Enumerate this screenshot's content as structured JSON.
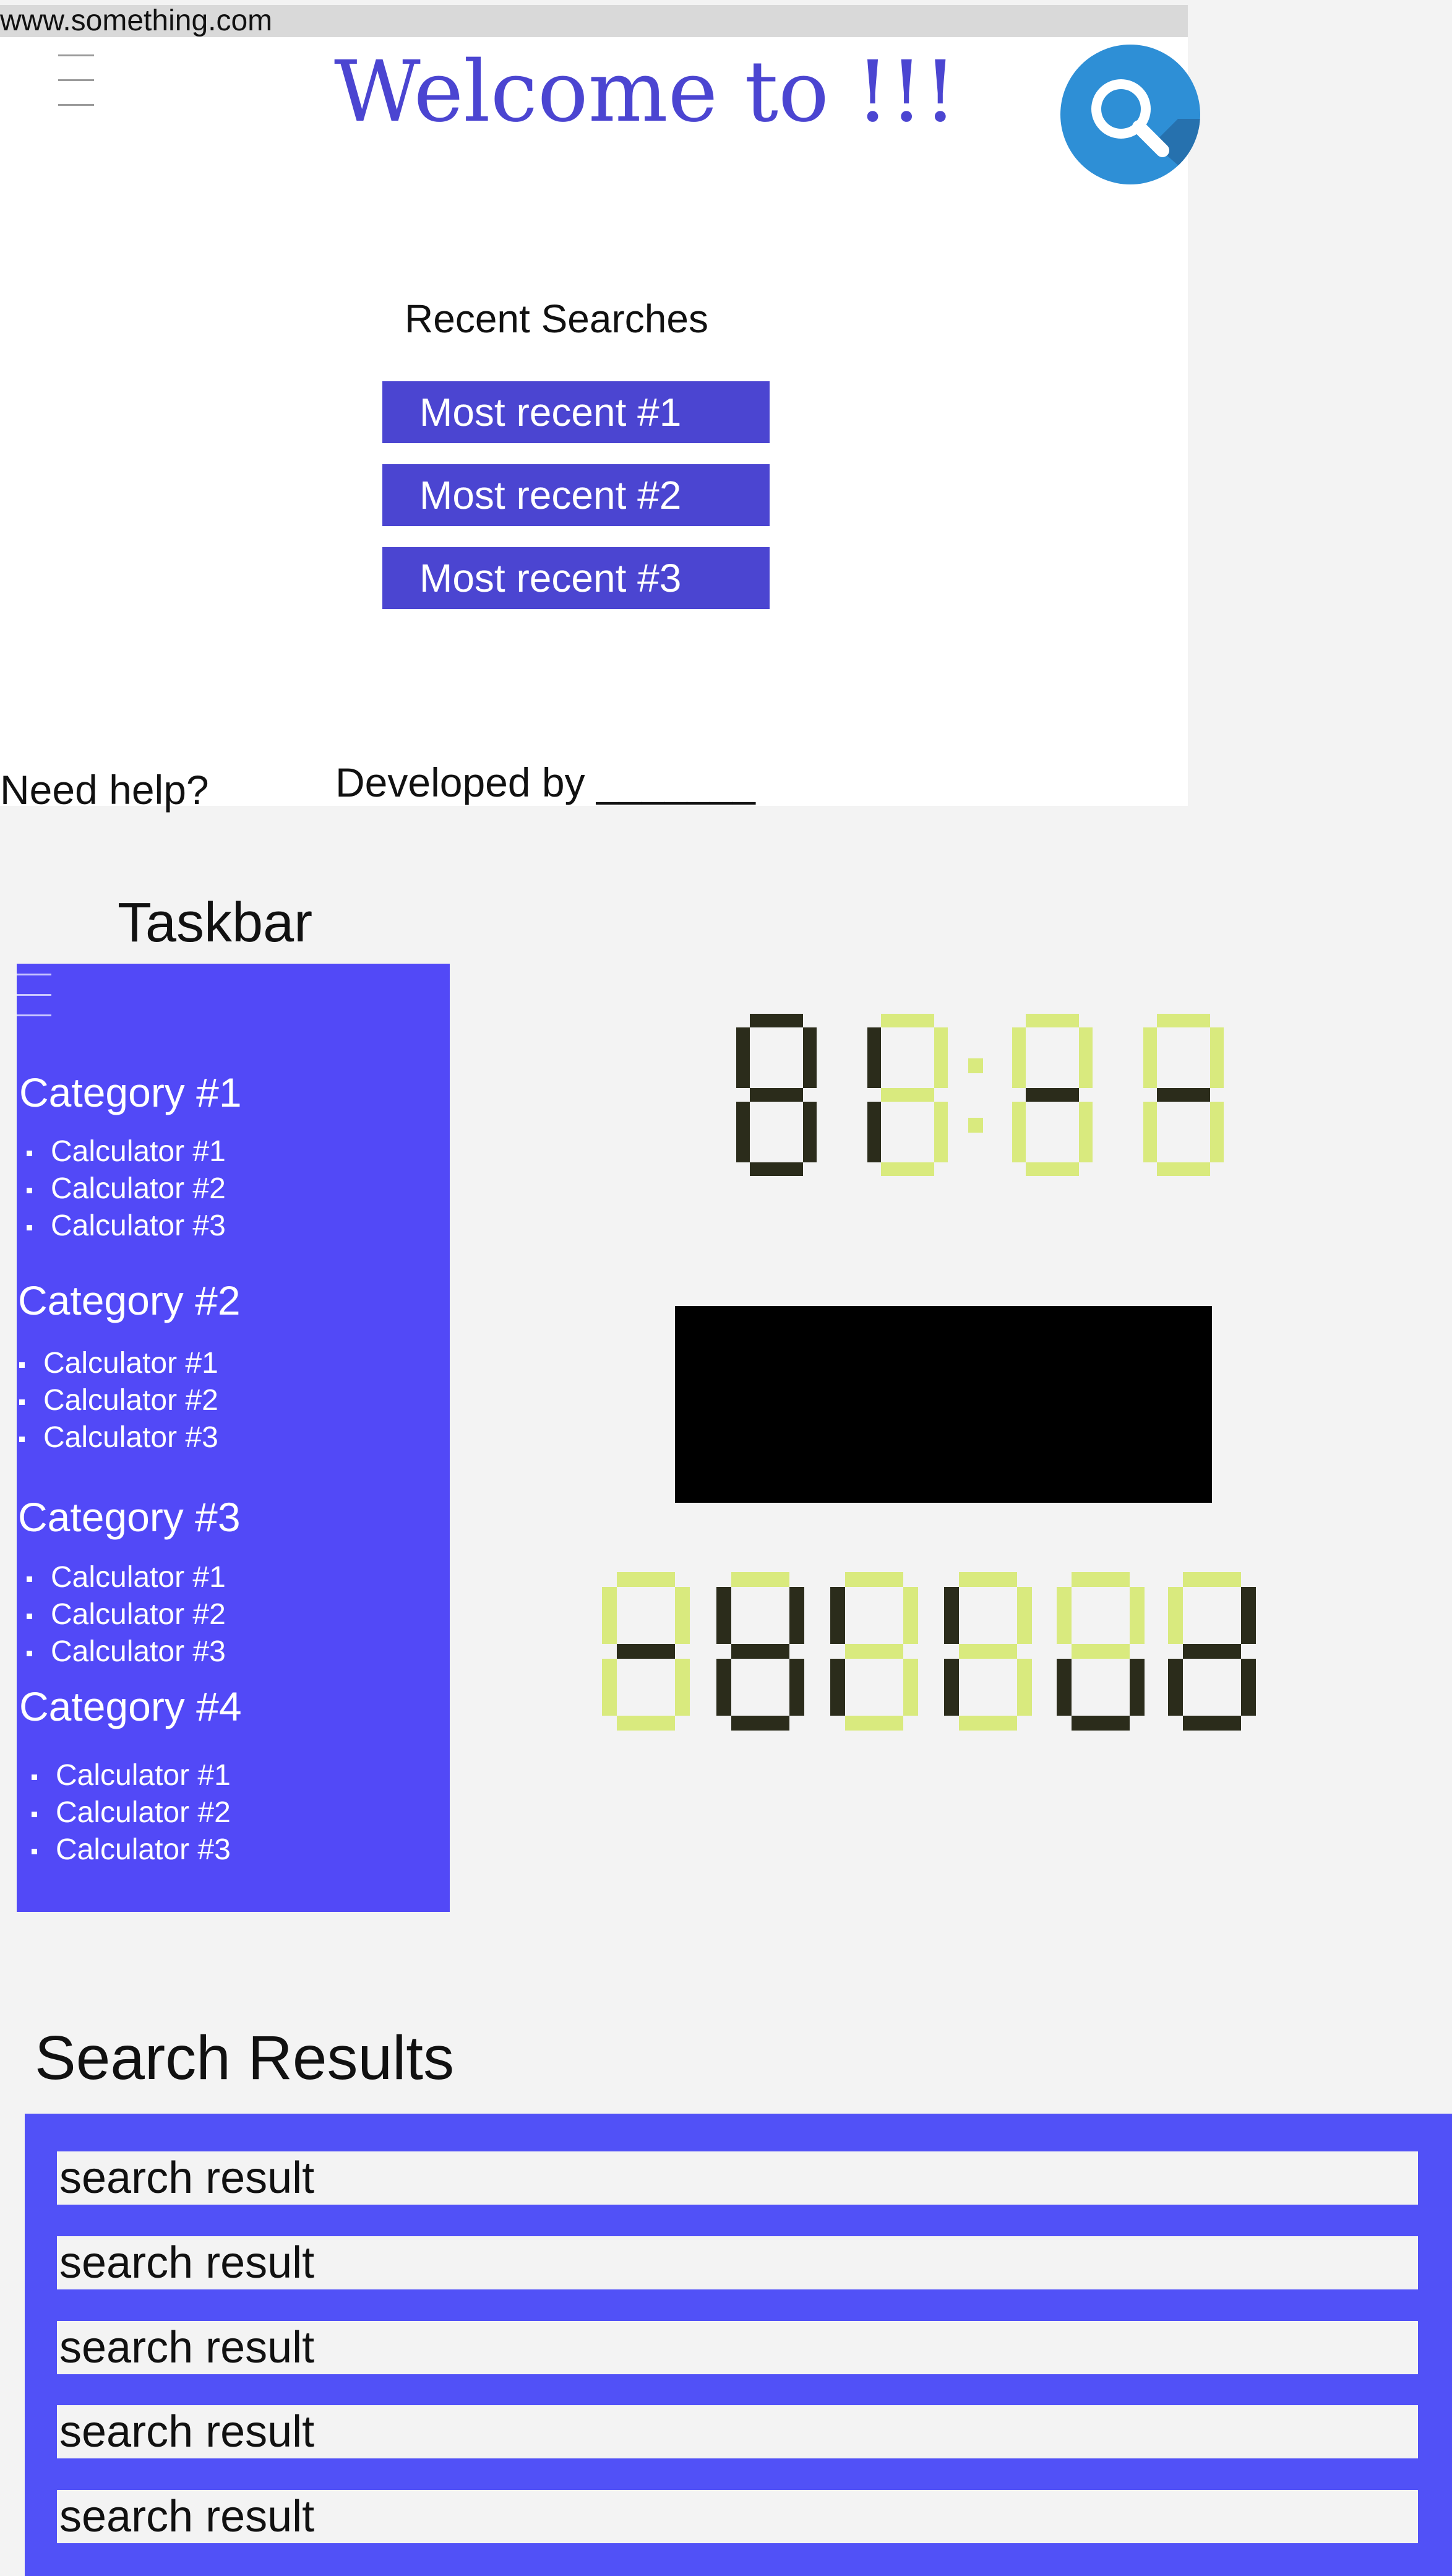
{
  "browser": {
    "url": "www.something.com"
  },
  "header": {
    "title": "Welcome to !!!"
  },
  "recent": {
    "title": "Recent Searches",
    "items": [
      "Most recent #1",
      "Most recent #2",
      "Most recent #3"
    ]
  },
  "footer": {
    "help": "Need help?",
    "developed_by": "Developed by _______"
  },
  "taskbar": {
    "title": "Taskbar",
    "categories": [
      {
        "name": "Category #1",
        "items": [
          "Calculator #1",
          "Calculator #2",
          "Calculator #3"
        ]
      },
      {
        "name": "Category #2",
        "items": [
          "Calculator #1",
          "Calculator #2",
          "Calculator #3"
        ]
      },
      {
        "name": "Category #3",
        "items": [
          "Calculator #1",
          "Calculator #2",
          "Calculator #3"
        ]
      },
      {
        "name": "Category #4",
        "items": [
          "Calculator #1",
          "Calculator #2",
          "Calculator #3"
        ]
      }
    ]
  },
  "displays": {
    "clock_digits": [
      "8",
      "8",
      "8",
      "8"
    ],
    "counter_digits": [
      "8",
      "8",
      "8",
      "8",
      "8",
      "8"
    ],
    "colors": {
      "on": "#2b2c1b",
      "off": "#d9ea7e"
    }
  },
  "results": {
    "title": "Search Results",
    "items": [
      "search result",
      "search result",
      "search result",
      "search result",
      "search result"
    ]
  },
  "colors": {
    "accent": "#4b45d1",
    "panel": "#5249f7",
    "search_icon_bg": "#2e8fd6"
  }
}
